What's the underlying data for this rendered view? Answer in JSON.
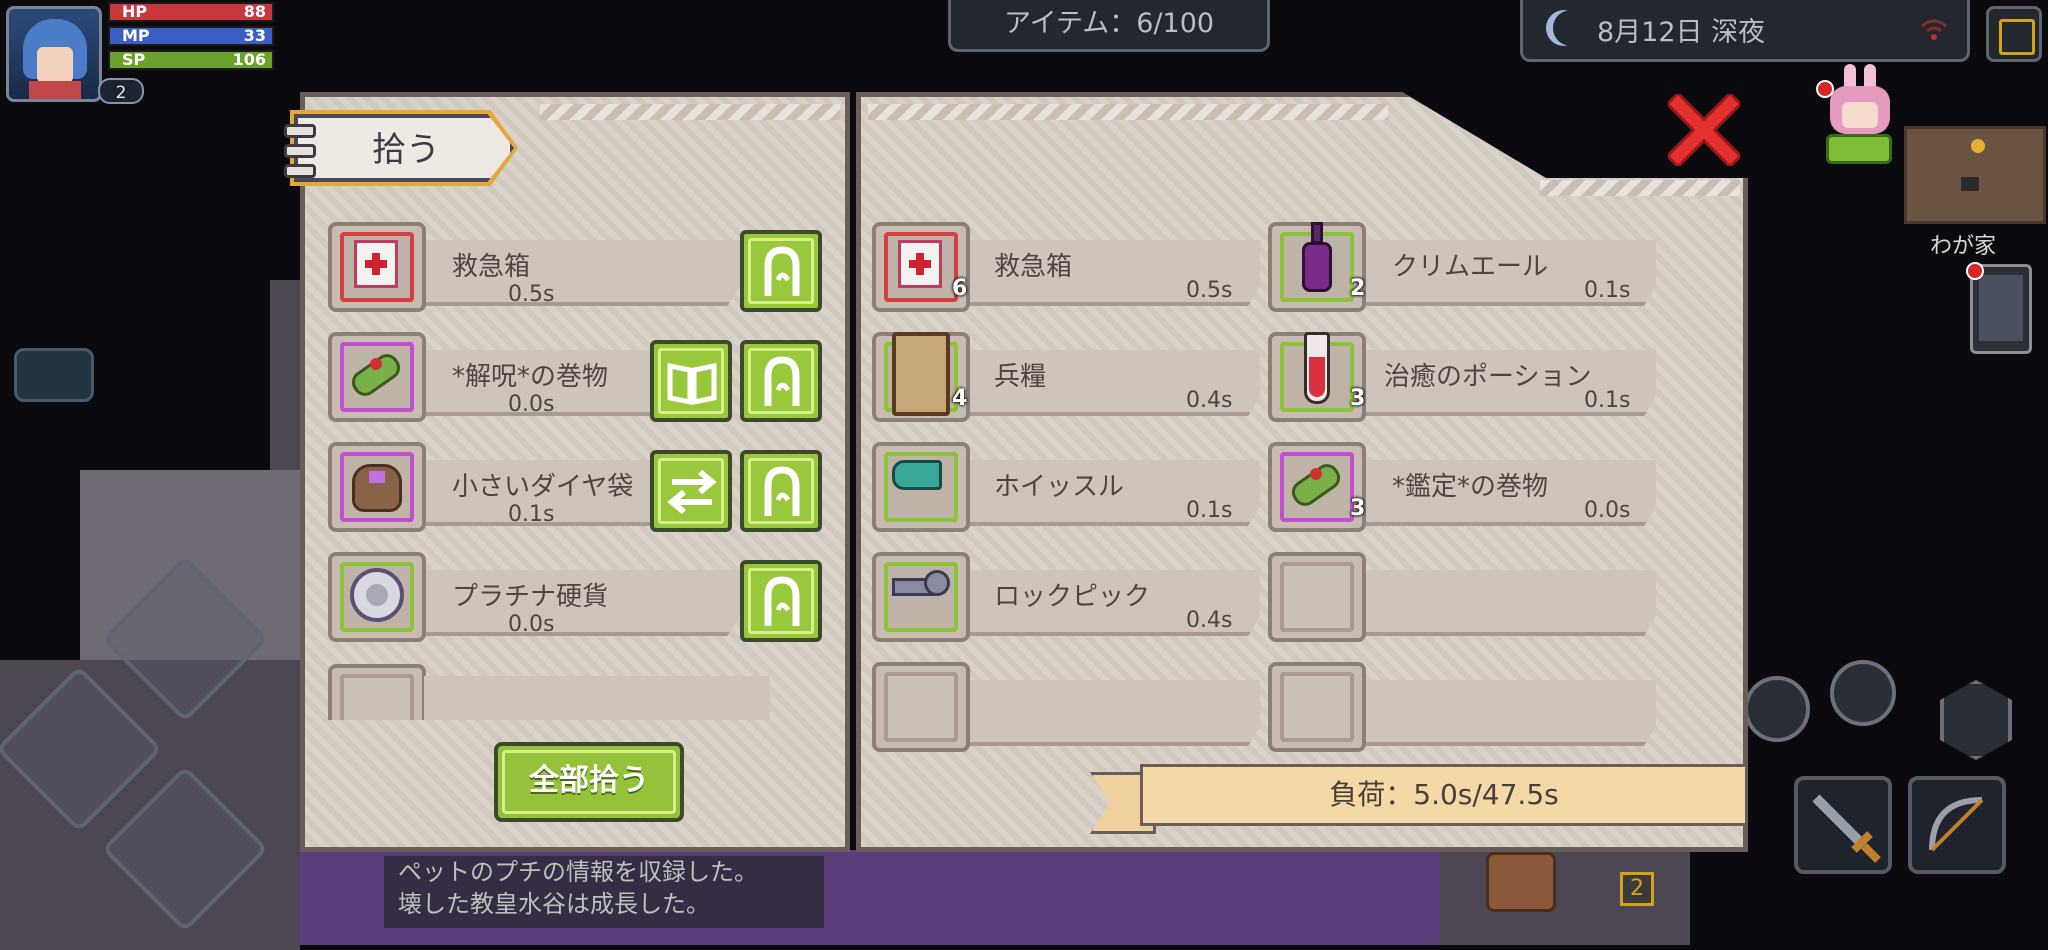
{
  "hud": {
    "level": "2",
    "hp": {
      "label": "HP",
      "value": "88",
      "fill": 1.0
    },
    "mp": {
      "label": "MP",
      "value": "33",
      "fill": 1.0
    },
    "sp": {
      "label": "SP",
      "value": "106",
      "fill": 1.0
    }
  },
  "top": {
    "item_count": "アイテム：6/100",
    "date": "8月12日  深夜",
    "map_label": "わが家"
  },
  "pickup_panel": {
    "title": "拾う",
    "items": [
      {
        "name": "救急箱",
        "time": "0.5s",
        "icon": "first-aid-icon",
        "frame": "red"
      },
      {
        "name": "*解呪*の巻物",
        "time": "0.0s",
        "icon": "scroll-icon",
        "frame": "purp"
      },
      {
        "name": "小さいダイヤ袋",
        "time": "0.1s",
        "icon": "diamond-bag-icon",
        "frame": "purp"
      },
      {
        "name": "プラチナ硬貨",
        "time": "0.0s",
        "icon": "platinum-coin-icon",
        "frame": "green"
      }
    ],
    "pick_all_label": "全部拾う"
  },
  "inventory_panel": {
    "items": [
      {
        "name": "救急箱",
        "time": "0.5s",
        "count": "6",
        "icon": "first-aid-icon",
        "frame": "red"
      },
      {
        "name": "クリムエール",
        "time": "0.1s",
        "count": "2",
        "icon": "bottle-icon",
        "frame": "green"
      },
      {
        "name": "兵糧",
        "time": "0.4s",
        "count": "4",
        "icon": "ration-scroll-icon",
        "frame": "green"
      },
      {
        "name": "治癒のポーション",
        "time": "0.1s",
        "count": "3",
        "icon": "potion-icon",
        "frame": "green"
      },
      {
        "name": "ホイッスル",
        "time": "0.1s",
        "count": "",
        "icon": "whistle-icon",
        "frame": "green"
      },
      {
        "name": "*鑑定*の巻物",
        "time": "0.0s",
        "count": "3",
        "icon": "scroll-icon",
        "frame": "purp"
      },
      {
        "name": "ロックピック",
        "time": "0.4s",
        "count": "",
        "icon": "lockpick-icon",
        "frame": "green"
      }
    ],
    "load": "負荷：5.0s/47.5s"
  },
  "messages": [
    "ペットのプチの情報を収録した。",
    "壊した教皇水谷は成長した。"
  ],
  "colors": {
    "accent_green": "#9ac83c",
    "close_red": "#e53030",
    "load_bar": "#f3d9a6"
  }
}
